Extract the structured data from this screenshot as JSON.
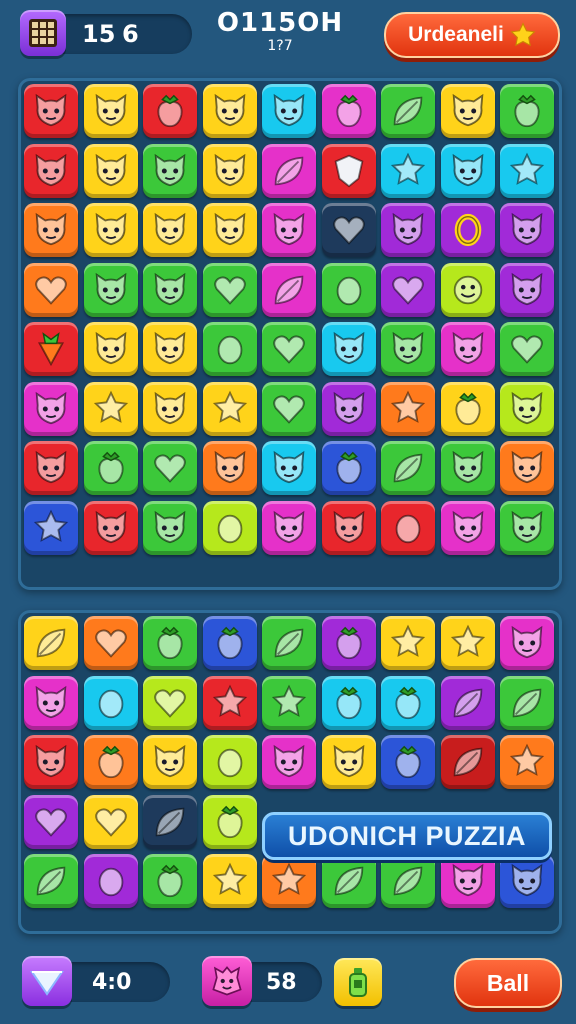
{
  "hud": {
    "level_value": "15",
    "moves_value": "6",
    "score_title": "O115OH",
    "score_sub": "1?7",
    "top_button_label": "Urdeaneli",
    "gem_count": "4:0",
    "creature_count": "58",
    "bottom_button_label": "Ball"
  },
  "banner": {
    "label": "UDONICH PUZZIA"
  },
  "colors": {
    "background": "#23577e",
    "red": "#e8262c",
    "yellow": "#ffd31a",
    "green": "#3cc83a",
    "cyan": "#18c9ef",
    "purple": "#a12ad8",
    "magenta": "#e531c9",
    "orange": "#ff7a1c",
    "blue": "#2c55d8",
    "lime": "#b6e81c",
    "darkred": "#c81d1d",
    "dark": "#1e3a5c"
  },
  "board_top": [
    [
      [
        "red",
        "cat"
      ],
      [
        "yellow",
        "cat"
      ],
      [
        "red",
        "berry"
      ],
      [
        "yellow",
        "cat"
      ],
      [
        "cyan",
        "cat"
      ],
      [
        "magenta",
        "berry"
      ],
      [
        "green",
        "leaf"
      ],
      [
        "yellow",
        "cat"
      ],
      [
        "green",
        "berry"
      ]
    ],
    [
      [
        "red",
        "cat"
      ],
      [
        "yellow",
        "cat"
      ],
      [
        "green",
        "cat"
      ],
      [
        "yellow",
        "cat"
      ],
      [
        "magenta",
        "leaf"
      ],
      [
        "red",
        "shield"
      ],
      [
        "cyan",
        "star"
      ],
      [
        "cyan",
        "cat"
      ],
      [
        "cyan",
        "star"
      ]
    ],
    [
      [
        "orange",
        "cat"
      ],
      [
        "yellow",
        "cat"
      ],
      [
        "yellow",
        "cat"
      ],
      [
        "yellow",
        "cat"
      ],
      [
        "magenta",
        "cat"
      ],
      [
        "dark",
        "heart"
      ],
      [
        "purple",
        "cat"
      ],
      [
        "purple",
        "ring"
      ],
      [
        "purple",
        "cat"
      ]
    ],
    [
      [
        "orange",
        "heart"
      ],
      [
        "green",
        "cat"
      ],
      [
        "green",
        "cat"
      ],
      [
        "green",
        "heart"
      ],
      [
        "magenta",
        "leaf"
      ],
      [
        "green",
        "lemon"
      ],
      [
        "purple",
        "heart"
      ],
      [
        "lime",
        "smile"
      ],
      [
        "purple",
        "cat"
      ]
    ],
    [
      [
        "red",
        "carrot"
      ],
      [
        "yellow",
        "cat"
      ],
      [
        "yellow",
        "cat"
      ],
      [
        "green",
        "lemon"
      ],
      [
        "green",
        "heart"
      ],
      [
        "cyan",
        "cat"
      ],
      [
        "green",
        "cat"
      ],
      [
        "magenta",
        "cat"
      ],
      [
        "green",
        "heart"
      ]
    ],
    [
      [
        "magenta",
        "cat"
      ],
      [
        "yellow",
        "star"
      ],
      [
        "yellow",
        "cat"
      ],
      [
        "yellow",
        "star"
      ],
      [
        "green",
        "heart"
      ],
      [
        "purple",
        "cat"
      ],
      [
        "orange",
        "star"
      ],
      [
        "yellow",
        "berry"
      ],
      [
        "lime",
        "cat"
      ]
    ],
    [
      [
        "red",
        "cat"
      ],
      [
        "green",
        "berry"
      ],
      [
        "green",
        "heart"
      ],
      [
        "orange",
        "cat"
      ],
      [
        "cyan",
        "cat"
      ],
      [
        "blue",
        "berry"
      ],
      [
        "green",
        "leaf"
      ],
      [
        "green",
        "cat"
      ],
      [
        "orange",
        "cat"
      ]
    ],
    [
      [
        "blue",
        "star"
      ],
      [
        "red",
        "cat"
      ],
      [
        "green",
        "cat"
      ],
      [
        "lime",
        "lemon"
      ],
      [
        "magenta",
        "cat"
      ],
      [
        "red",
        "cat"
      ],
      [
        "red",
        "lemon"
      ],
      [
        "magenta",
        "cat"
      ],
      [
        "green",
        "cat"
      ]
    ]
  ],
  "board_bottom": [
    [
      [
        "yellow",
        "leaf"
      ],
      [
        "orange",
        "heart"
      ],
      [
        "green",
        "berry"
      ],
      [
        "blue",
        "berry"
      ],
      [
        "green",
        "leaf"
      ],
      [
        "purple",
        "berry"
      ],
      [
        "yellow",
        "star"
      ],
      [
        "yellow",
        "star"
      ],
      [
        "magenta",
        "cat"
      ]
    ],
    [
      [
        "magenta",
        "cat"
      ],
      [
        "cyan",
        "lemon"
      ],
      [
        "lime",
        "heart"
      ],
      [
        "red",
        "star"
      ],
      [
        "green",
        "star"
      ],
      [
        "cyan",
        "berry"
      ],
      [
        "cyan",
        "berry"
      ],
      [
        "purple",
        "leaf"
      ],
      [
        "green",
        "leaf"
      ]
    ],
    [
      [
        "red",
        "cat"
      ],
      [
        "orange",
        "berry"
      ],
      [
        "yellow",
        "cat"
      ],
      [
        "lime",
        "lemon"
      ],
      [
        "magenta",
        "cat"
      ],
      [
        "yellow",
        "cat"
      ],
      [
        "blue",
        "berry"
      ],
      [
        "darkred",
        "leaf"
      ],
      [
        "orange",
        "star"
      ]
    ],
    [
      [
        "purple",
        "heart"
      ],
      [
        "yellow",
        "heart"
      ],
      [
        "dark",
        "leaf"
      ],
      [
        "lime",
        "berry"
      ],
      [
        null,
        null
      ],
      [
        null,
        null
      ],
      [
        null,
        null
      ],
      [
        null,
        null
      ],
      [
        null,
        null
      ]
    ],
    [
      [
        "green",
        "leaf"
      ],
      [
        "purple",
        "lemon"
      ],
      [
        "green",
        "berry"
      ],
      [
        "yellow",
        "star"
      ],
      [
        "orange",
        "star"
      ],
      [
        "green",
        "leaf"
      ],
      [
        "green",
        "leaf"
      ],
      [
        "magenta",
        "cat"
      ],
      [
        "blue",
        "cat"
      ]
    ]
  ]
}
